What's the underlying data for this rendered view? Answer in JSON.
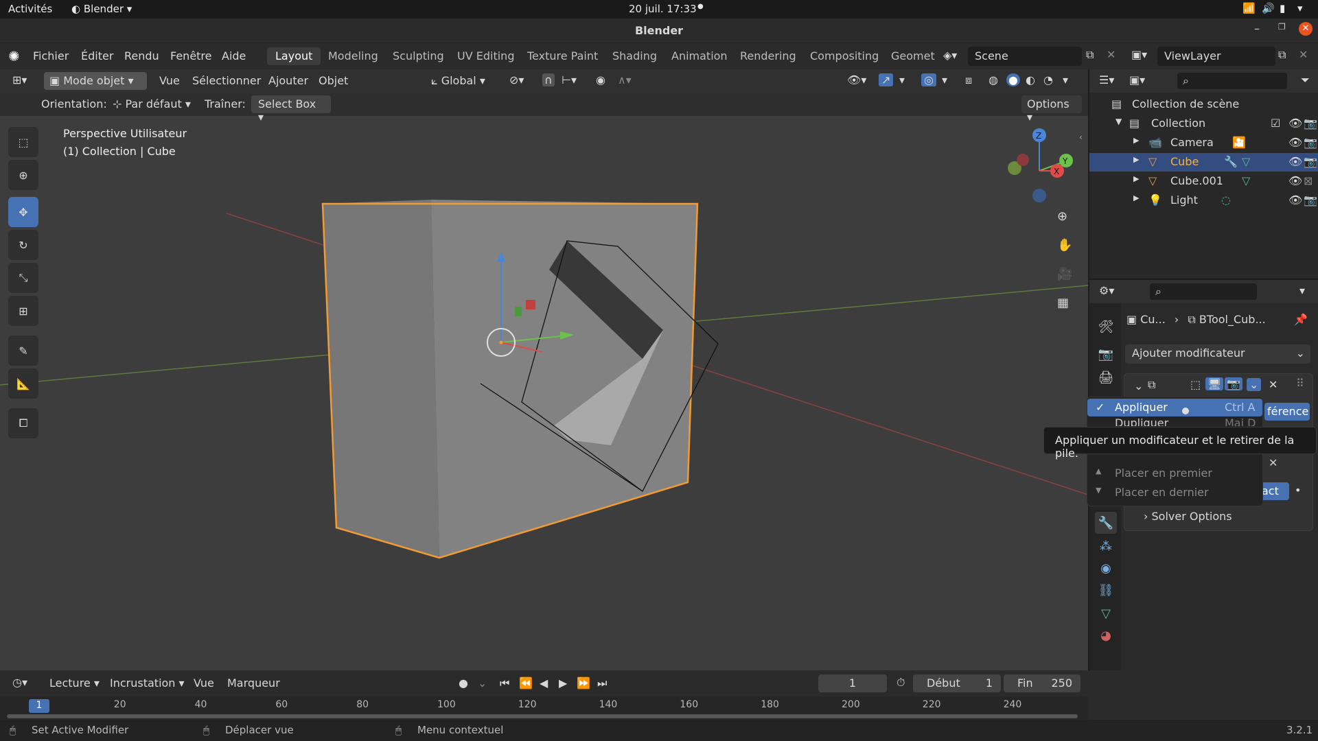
{
  "gnome": {
    "activities": "Activités",
    "app": "Blender",
    "clock": "20 juil.  17:33"
  },
  "window": {
    "title": "Blender"
  },
  "menu": {
    "items": [
      "Fichier",
      "Éditer",
      "Rendu",
      "Fenêtre",
      "Aide"
    ]
  },
  "workspaces": [
    "Layout",
    "Modeling",
    "Sculpting",
    "UV Editing",
    "Texture Paint",
    "Shading",
    "Animation",
    "Rendering",
    "Compositing",
    "Geomet"
  ],
  "scene": {
    "name": "Scene",
    "view_layer": "ViewLayer"
  },
  "viewport_header": {
    "mode": "Mode objet",
    "vue": "Vue",
    "select": "Sélectionner",
    "add": "Ajouter",
    "object": "Objet",
    "transform": "Global"
  },
  "tool_header": {
    "orientation_label": "Orientation:",
    "orientation_value": "Par défaut",
    "drag_label": "Traîner:",
    "drag_value": "Select Box",
    "options": "Options"
  },
  "viewport": {
    "line1": "Perspective Utilisateur",
    "line2": "(1) Collection | Cube"
  },
  "outliner": {
    "scene_collection": "Collection de scène",
    "collection": "Collection",
    "items": [
      {
        "name": "Camera"
      },
      {
        "name": "Cube"
      },
      {
        "name": "Cube.001"
      },
      {
        "name": "Light"
      }
    ]
  },
  "properties": {
    "breadcrumb_obj": "Cu...",
    "breadcrumb_mod": "BTool_Cub...",
    "add_modifier": "Ajouter modificateur",
    "difference_tail": "férence",
    "exact_tail": "act",
    "solver_options": "Solver Options"
  },
  "context_menu": {
    "apply": "Appliquer",
    "apply_shortcut": "Ctrl A",
    "duplicate": "Dupliquer",
    "duplicate_shortcut": "Maj D",
    "move_first": "Placer en premier",
    "move_last": "Placer en dernier"
  },
  "tooltip": "Appliquer un modificateur et le retirer de la pile.",
  "timeline": {
    "menus": [
      "Lecture",
      "Incrustation",
      "Vue",
      "Marqueur"
    ],
    "frame": "1",
    "start_label": "Début",
    "start": "1",
    "end_label": "Fin",
    "end": "250",
    "ticks": [
      "20",
      "40",
      "60",
      "80",
      "100",
      "120",
      "140",
      "160",
      "180",
      "200",
      "220",
      "240"
    ],
    "current": "1"
  },
  "status": {
    "left": "Set Active Modifier",
    "mid": "Déplacer vue",
    "right": "Menu contextuel",
    "version": "3.2.1"
  },
  "colors": {
    "accent": "#4672b3",
    "selection": "#f29b35",
    "ui_bg": "#2b2b2b",
    "viewport_bg": "#3d3d3d"
  }
}
